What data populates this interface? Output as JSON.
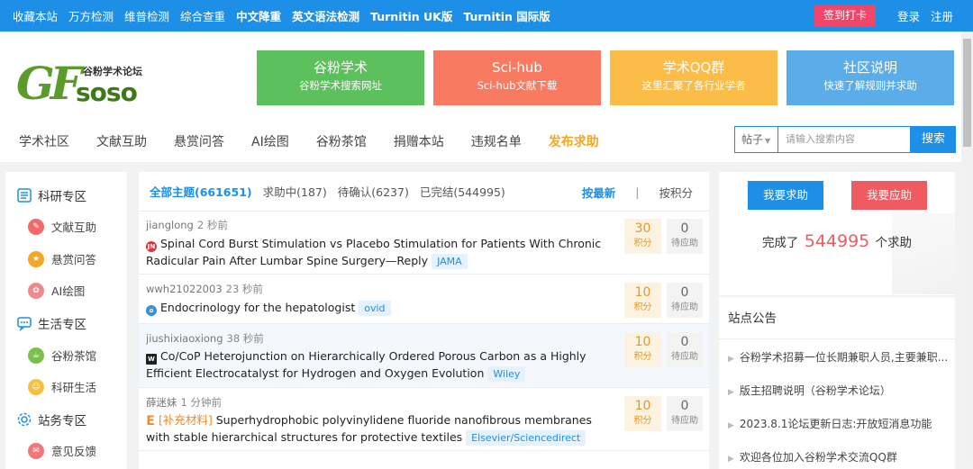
{
  "topbar": {
    "nav": [
      "收藏本站",
      "万方检测",
      "维普检测",
      "综合查重",
      "中文降重",
      "英文语法检测",
      "Turnitin UK版",
      "Turnitin 国际版"
    ],
    "checkin": "签到打卡",
    "login": "登录",
    "register": "注册"
  },
  "logo": {
    "gf": "GF",
    "soso": "soso",
    "cn": "谷粉学术论坛"
  },
  "cards": [
    {
      "title": "谷粉学术",
      "sub": "谷粉学术搜索网址",
      "color": "#5cc05c"
    },
    {
      "title": "Sci-hub",
      "sub": "Sci-hub文献下载",
      "color": "#f87a60"
    },
    {
      "title": "学术QQ群",
      "sub": "这里汇聚了各行业学者",
      "color": "#fcbd48"
    },
    {
      "title": "社区说明",
      "sub": "快速了解规则并求助",
      "color": "#5aade8"
    }
  ],
  "subnav": [
    "学术社区",
    "文献互助",
    "悬赏问答",
    "AI绘图",
    "谷粉茶馆",
    "捐赠本站",
    "违规名单",
    "发布求助"
  ],
  "search": {
    "select": "帖子",
    "placeholder": "请输入搜索内容",
    "button": "搜索"
  },
  "sidebar": {
    "groups": [
      {
        "label": "科研专区",
        "items": [
          {
            "label": "文献互助",
            "color": "#f06a6a"
          },
          {
            "label": "悬赏问答",
            "color": "#f5a623"
          },
          {
            "label": "AI绘图",
            "color": "#f08a8a"
          }
        ]
      },
      {
        "label": "生活专区",
        "items": [
          {
            "label": "谷粉茶馆",
            "color": "#7cc04a"
          },
          {
            "label": "科研生活",
            "color": "#f5c040"
          }
        ]
      },
      {
        "label": "站务专区",
        "items": [
          {
            "label": "意见反馈",
            "color": "#f07878"
          }
        ]
      }
    ]
  },
  "tabs": {
    "all": "全部主题(661651)",
    "seeking": "求助中(187)",
    "pending": "待确认(6237)",
    "done": "已完结(544995)",
    "sort_new": "按最新",
    "sep": "|",
    "sort_points": "按积分"
  },
  "threads": [
    {
      "user": "jianglong",
      "time": "2 秒前",
      "title": "Spinal Cord Burst Stimulation vs Placebo Stimulation for Patients With Chronic Radicular Pain After Lumbar Spine Surgery—Reply",
      "tag": "JAMA",
      "points": "30",
      "points_label": "积分",
      "wait": "0",
      "wait_label": "待应助",
      "icon": "JN",
      "icon_color": "#d9363e"
    },
    {
      "user": "wwh21022003",
      "time": "23 秒前",
      "title": "Endocrinology for the hepatologist",
      "tag": "ovid",
      "points": "10",
      "points_label": "积分",
      "wait": "0",
      "wait_label": "待应助",
      "icon": "o",
      "icon_color": "#3a8fd6"
    },
    {
      "user": "jiushixiaoxiong",
      "time": "38 秒前",
      "title": "Co/CoP Heterojunction on Hierarchically Ordered Porous Carbon as a Highly Efficient Electrocatalyst for Hydrogen and Oxygen Evolution",
      "tag": "Wiley",
      "points": "10",
      "points_label": "积分",
      "wait": "0",
      "wait_label": "待应助",
      "icon": "W",
      "icon_color": "#222222"
    },
    {
      "user": "薛迷妹",
      "time": "1 分钟前",
      "title_prefix": "[补充材料]",
      "title": "Superhydrophobic polyvinylidene fluoride nanofibrous membranes with stable hierarchical structures for protective textiles",
      "tag": "Elsevier/Sciencedirect",
      "points": "10",
      "points_label": "积分",
      "wait": "0",
      "wait_label": "待应助",
      "icon": "E",
      "icon_color": "#f08a24"
    }
  ],
  "right": {
    "ask": "我要求助",
    "help": "我要应助",
    "done_prefix": "完成了",
    "done_count": "544995",
    "done_suffix": "个求助"
  },
  "notice": {
    "title": "站点公告",
    "items": [
      "谷粉学术招募一位长期兼职人员,主要兼职...",
      "版主招聘说明（谷粉学术论坛）",
      "2023.8.1论坛更新日志:开放短消息功能",
      "欢迎各位加入谷粉学术交流QQ群"
    ]
  }
}
